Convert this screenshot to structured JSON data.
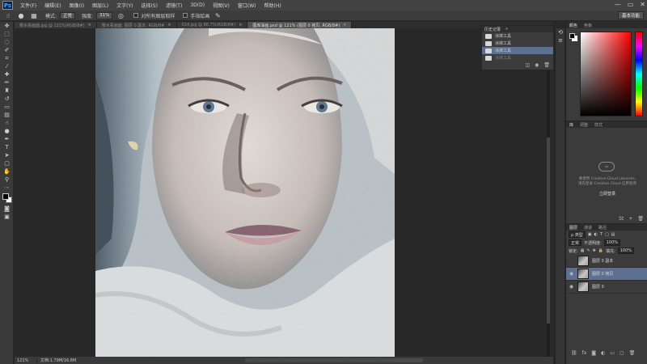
{
  "app": {
    "logo": "Ps"
  },
  "menubar": {
    "items": [
      "文件(F)",
      "编辑(E)",
      "图像(I)",
      "图层(L)",
      "文字(Y)",
      "选择(S)",
      "滤镜(T)",
      "3D(D)",
      "视图(V)",
      "窗口(W)",
      "帮助(H)"
    ]
  },
  "window_controls": {
    "minimize": "—",
    "maximize": "▭",
    "close": "✕"
  },
  "options_bar": {
    "mode_label": "模式:",
    "mode_value": "正常",
    "opacity_label": "强度:",
    "opacity_value": "31%",
    "sample_all_label": "对所有图层取样",
    "finger_paint_label": "手指绘画",
    "workspace": "基本功能"
  },
  "tabs": [
    {
      "label": "樱水看画面.jpg @ 121%(RGB/8#)",
      "active": false
    },
    {
      "label": "樱水看画面, 图层 0 副本, RGB/8#",
      "active": false
    },
    {
      "label": "014.jpg @ 66.7%(RGB/8#)",
      "active": false
    },
    {
      "label": "图库油画.psd @ 121% (图层 0 拷贝, RGB/8#)",
      "active": true
    }
  ],
  "tab_close": "×",
  "history": {
    "tabs": [
      "历史记录",
      "»"
    ],
    "rows": [
      {
        "label": "涂抹工具",
        "state": "normal"
      },
      {
        "label": "涂抹工具",
        "state": "normal"
      },
      {
        "label": "涂抹工具",
        "state": "selected"
      },
      {
        "label": "涂抹工具",
        "state": "dim"
      }
    ]
  },
  "color_panel": {
    "tabs": [
      "颜色",
      "色板"
    ]
  },
  "libraries_panel": {
    "tabs": [
      "库",
      "调整",
      "样式"
    ],
    "message_line1": "要使用 Creative Cloud Libraries,",
    "message_line2": "请先登录 Creative Cloud 应用程序",
    "link": "立即登录"
  },
  "layers_panel": {
    "tabs": [
      "图层",
      "通道",
      "路径"
    ],
    "filter_kind": "ρ 类型",
    "blend_mode": "正常",
    "opacity_label": "不透明度:",
    "opacity_value": "100%",
    "lock_label": "锁定:",
    "fill_label": "填充:",
    "fill_value": "100%",
    "layers": [
      {
        "name": "图层 0 副本",
        "visible": false,
        "selected": false
      },
      {
        "name": "图层 0 拷贝",
        "visible": true,
        "selected": true
      },
      {
        "name": "图层 0",
        "visible": true,
        "selected": false
      }
    ]
  },
  "status_bar": {
    "zoom": "121%",
    "doc_info": "文档:1.79M/16.8M"
  }
}
